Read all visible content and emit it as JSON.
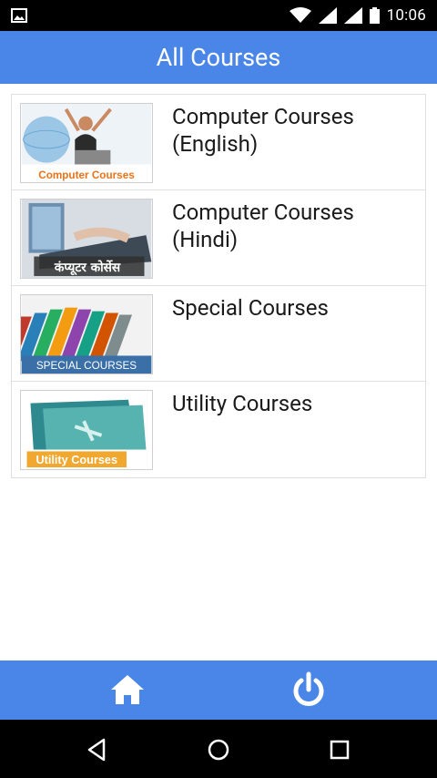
{
  "status_bar": {
    "time": "10:06",
    "icons": [
      "image-icon",
      "wifi-icon",
      "signal-icon",
      "signal-icon",
      "battery-icon"
    ]
  },
  "app_bar": {
    "title": "All Courses"
  },
  "courses": [
    {
      "title": "Computer Courses (English)",
      "thumb_caption": "Computer Courses",
      "thumb_icon": "laptop-woman-image"
    },
    {
      "title": "Computer Courses (Hindi)",
      "thumb_caption": "कंप्यूटर कोर्सेस",
      "thumb_icon": "keyboard-hands-image"
    },
    {
      "title": "Special Courses",
      "thumb_caption": "SPECIAL COURSES",
      "thumb_icon": "books-image"
    },
    {
      "title": "Utility Courses",
      "thumb_caption": "Utility Courses",
      "thumb_icon": "tools-folder-image"
    }
  ],
  "bottom_bar": {
    "icons": [
      "home-icon",
      "power-icon"
    ]
  },
  "nav_bar": {
    "icons": [
      "back-icon",
      "home-circle-icon",
      "recents-icon"
    ]
  },
  "colors": {
    "primary": "#4a86e8",
    "status": "#000000",
    "caption_orange": "#e8731a"
  }
}
